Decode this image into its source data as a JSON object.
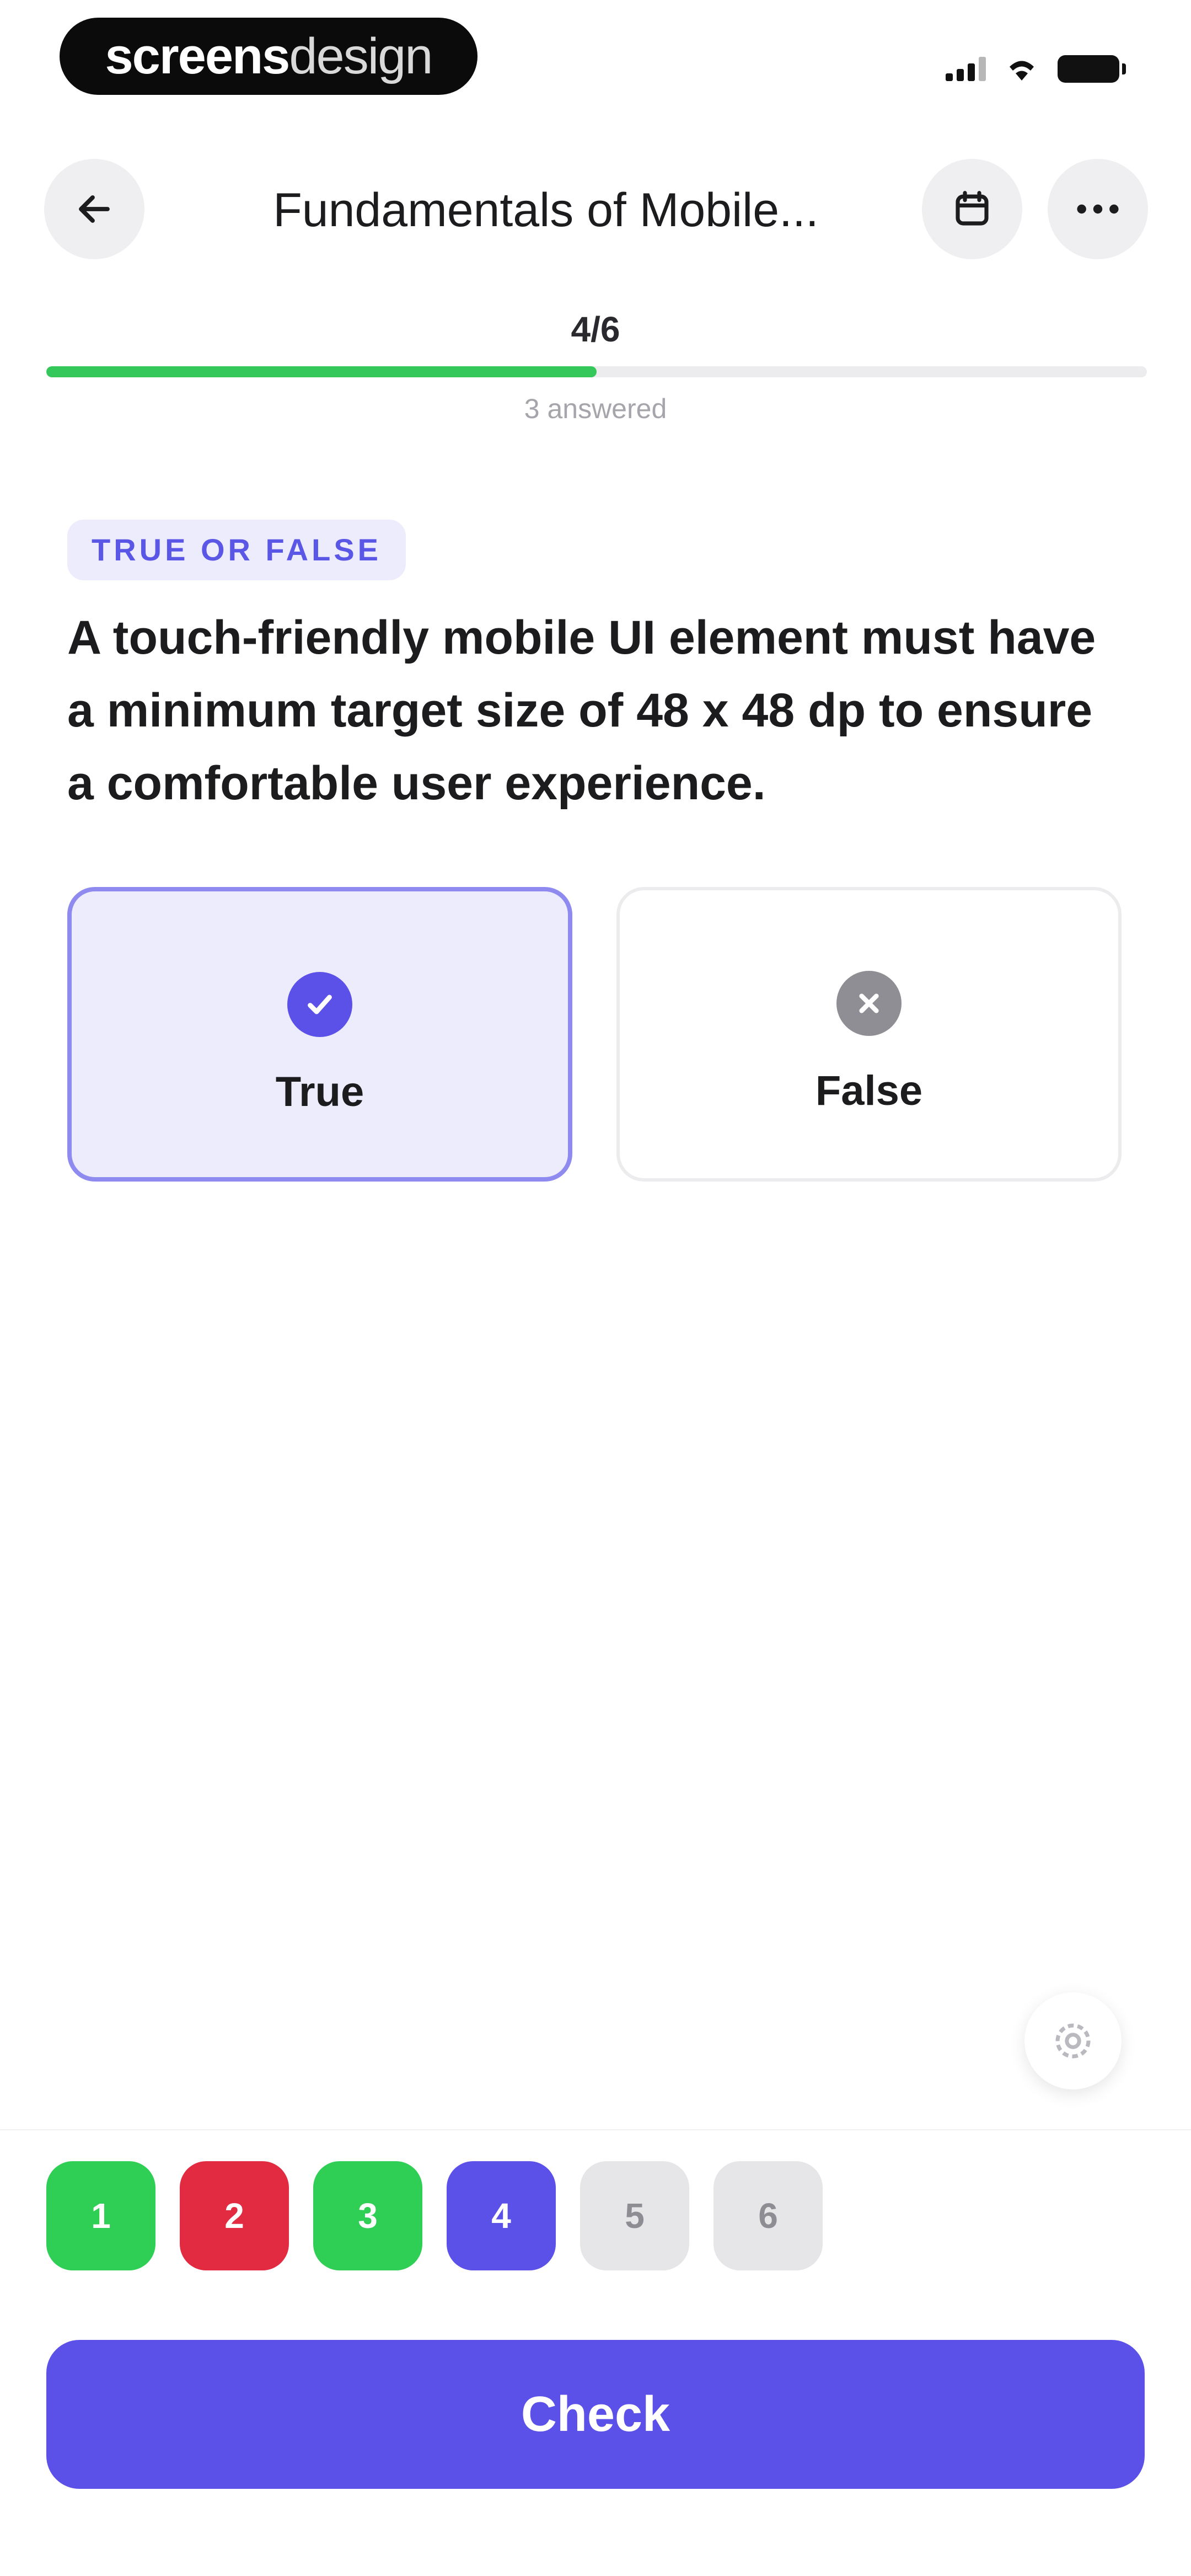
{
  "status_bar": {
    "brand_bold": "screens",
    "brand_light": "design"
  },
  "header": {
    "title": "Fundamentals of Mobile..."
  },
  "progress": {
    "label": "4/6",
    "fraction": 0.5,
    "answered": "3 answered"
  },
  "question": {
    "tag": "TRUE OR FALSE",
    "text": "A touch-friendly mobile UI element must have a minimum target size of 48 x 48 dp to ensure a comfortable user experience."
  },
  "options": [
    {
      "label": "True",
      "selected": true,
      "icon": "check-circle-icon"
    },
    {
      "label": "False",
      "selected": false,
      "icon": "x-circle-icon"
    }
  ],
  "question_nav": [
    {
      "label": "1",
      "state": "correct"
    },
    {
      "label": "2",
      "state": "wrong"
    },
    {
      "label": "3",
      "state": "correct"
    },
    {
      "label": "4",
      "state": "current"
    },
    {
      "label": "5",
      "state": "pending"
    },
    {
      "label": "6",
      "state": "pending"
    }
  ],
  "actions": {
    "check_label": "Check"
  },
  "colors": {
    "accent": "#5b51e8",
    "correct": "#2fce55",
    "wrong": "#e22a40",
    "progress": "#34c759"
  }
}
